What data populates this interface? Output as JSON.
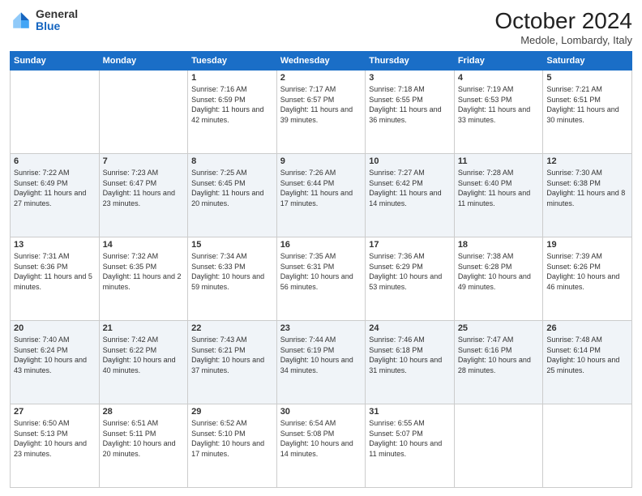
{
  "header": {
    "logo": {
      "general": "General",
      "blue": "Blue"
    },
    "title": "October 2024",
    "subtitle": "Medole, Lombardy, Italy"
  },
  "days_of_week": [
    "Sunday",
    "Monday",
    "Tuesday",
    "Wednesday",
    "Thursday",
    "Friday",
    "Saturday"
  ],
  "weeks": [
    [
      {
        "day": "",
        "info": ""
      },
      {
        "day": "",
        "info": ""
      },
      {
        "day": "1",
        "info": "Sunrise: 7:16 AM\nSunset: 6:59 PM\nDaylight: 11 hours and 42 minutes."
      },
      {
        "day": "2",
        "info": "Sunrise: 7:17 AM\nSunset: 6:57 PM\nDaylight: 11 hours and 39 minutes."
      },
      {
        "day": "3",
        "info": "Sunrise: 7:18 AM\nSunset: 6:55 PM\nDaylight: 11 hours and 36 minutes."
      },
      {
        "day": "4",
        "info": "Sunrise: 7:19 AM\nSunset: 6:53 PM\nDaylight: 11 hours and 33 minutes."
      },
      {
        "day": "5",
        "info": "Sunrise: 7:21 AM\nSunset: 6:51 PM\nDaylight: 11 hours and 30 minutes."
      }
    ],
    [
      {
        "day": "6",
        "info": "Sunrise: 7:22 AM\nSunset: 6:49 PM\nDaylight: 11 hours and 27 minutes."
      },
      {
        "day": "7",
        "info": "Sunrise: 7:23 AM\nSunset: 6:47 PM\nDaylight: 11 hours and 23 minutes."
      },
      {
        "day": "8",
        "info": "Sunrise: 7:25 AM\nSunset: 6:45 PM\nDaylight: 11 hours and 20 minutes."
      },
      {
        "day": "9",
        "info": "Sunrise: 7:26 AM\nSunset: 6:44 PM\nDaylight: 11 hours and 17 minutes."
      },
      {
        "day": "10",
        "info": "Sunrise: 7:27 AM\nSunset: 6:42 PM\nDaylight: 11 hours and 14 minutes."
      },
      {
        "day": "11",
        "info": "Sunrise: 7:28 AM\nSunset: 6:40 PM\nDaylight: 11 hours and 11 minutes."
      },
      {
        "day": "12",
        "info": "Sunrise: 7:30 AM\nSunset: 6:38 PM\nDaylight: 11 hours and 8 minutes."
      }
    ],
    [
      {
        "day": "13",
        "info": "Sunrise: 7:31 AM\nSunset: 6:36 PM\nDaylight: 11 hours and 5 minutes."
      },
      {
        "day": "14",
        "info": "Sunrise: 7:32 AM\nSunset: 6:35 PM\nDaylight: 11 hours and 2 minutes."
      },
      {
        "day": "15",
        "info": "Sunrise: 7:34 AM\nSunset: 6:33 PM\nDaylight: 10 hours and 59 minutes."
      },
      {
        "day": "16",
        "info": "Sunrise: 7:35 AM\nSunset: 6:31 PM\nDaylight: 10 hours and 56 minutes."
      },
      {
        "day": "17",
        "info": "Sunrise: 7:36 AM\nSunset: 6:29 PM\nDaylight: 10 hours and 53 minutes."
      },
      {
        "day": "18",
        "info": "Sunrise: 7:38 AM\nSunset: 6:28 PM\nDaylight: 10 hours and 49 minutes."
      },
      {
        "day": "19",
        "info": "Sunrise: 7:39 AM\nSunset: 6:26 PM\nDaylight: 10 hours and 46 minutes."
      }
    ],
    [
      {
        "day": "20",
        "info": "Sunrise: 7:40 AM\nSunset: 6:24 PM\nDaylight: 10 hours and 43 minutes."
      },
      {
        "day": "21",
        "info": "Sunrise: 7:42 AM\nSunset: 6:22 PM\nDaylight: 10 hours and 40 minutes."
      },
      {
        "day": "22",
        "info": "Sunrise: 7:43 AM\nSunset: 6:21 PM\nDaylight: 10 hours and 37 minutes."
      },
      {
        "day": "23",
        "info": "Sunrise: 7:44 AM\nSunset: 6:19 PM\nDaylight: 10 hours and 34 minutes."
      },
      {
        "day": "24",
        "info": "Sunrise: 7:46 AM\nSunset: 6:18 PM\nDaylight: 10 hours and 31 minutes."
      },
      {
        "day": "25",
        "info": "Sunrise: 7:47 AM\nSunset: 6:16 PM\nDaylight: 10 hours and 28 minutes."
      },
      {
        "day": "26",
        "info": "Sunrise: 7:48 AM\nSunset: 6:14 PM\nDaylight: 10 hours and 25 minutes."
      }
    ],
    [
      {
        "day": "27",
        "info": "Sunrise: 6:50 AM\nSunset: 5:13 PM\nDaylight: 10 hours and 23 minutes."
      },
      {
        "day": "28",
        "info": "Sunrise: 6:51 AM\nSunset: 5:11 PM\nDaylight: 10 hours and 20 minutes."
      },
      {
        "day": "29",
        "info": "Sunrise: 6:52 AM\nSunset: 5:10 PM\nDaylight: 10 hours and 17 minutes."
      },
      {
        "day": "30",
        "info": "Sunrise: 6:54 AM\nSunset: 5:08 PM\nDaylight: 10 hours and 14 minutes."
      },
      {
        "day": "31",
        "info": "Sunrise: 6:55 AM\nSunset: 5:07 PM\nDaylight: 10 hours and 11 minutes."
      },
      {
        "day": "",
        "info": ""
      },
      {
        "day": "",
        "info": ""
      }
    ]
  ]
}
